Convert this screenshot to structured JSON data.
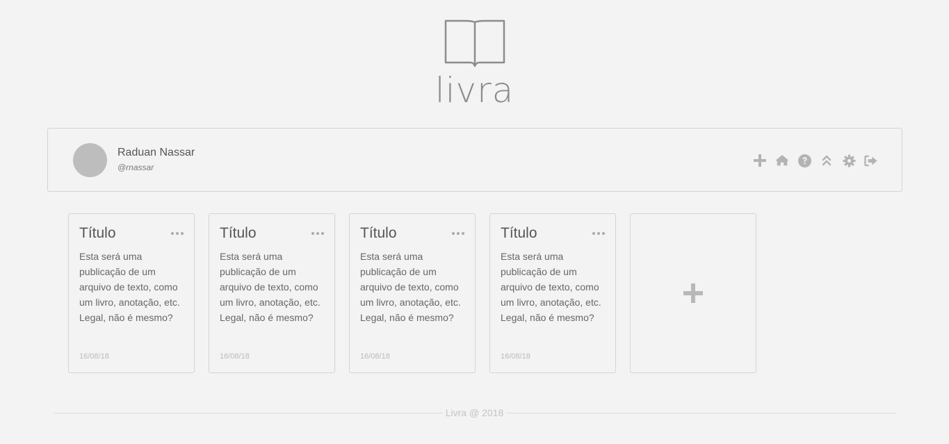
{
  "brand": {
    "name": "livra",
    "logo_icon": "open-book-icon"
  },
  "user": {
    "name": "Raduan Nassar",
    "handle": "@rnassar"
  },
  "toolbar": [
    {
      "icon": "plus-icon",
      "name": "add-button"
    },
    {
      "icon": "home-icon",
      "name": "home-button"
    },
    {
      "icon": "help-icon",
      "name": "help-button"
    },
    {
      "icon": "double-chevron-up-icon",
      "name": "collapse-button"
    },
    {
      "icon": "gear-icon",
      "name": "settings-button"
    },
    {
      "icon": "sign-out-icon",
      "name": "logout-button"
    }
  ],
  "cards": [
    {
      "title": "Título",
      "body": "Esta será uma publicação de um arquivo de texto, como um livro, anotação, etc. Legal, não é mesmo?",
      "date": "16/08/18"
    },
    {
      "title": "Título",
      "body": "Esta será uma publicação de um arquivo de texto, como um livro, anotação, etc. Legal, não é mesmo?",
      "date": "16/08/18"
    },
    {
      "title": "Título",
      "body": "Esta será uma publicação de um arquivo de texto, como um livro, anotação, etc. Legal, não é mesmo?",
      "date": "16/08/18"
    },
    {
      "title": "Título",
      "body": "Esta será uma publicação de um arquivo de texto, como um livro, anotação, etc. Legal, não é mesmo?",
      "date": "16/08/18"
    }
  ],
  "add_card_icon": "plus-icon",
  "footer": {
    "text": "Livra @ 2018"
  },
  "colors": {
    "background": "#f3f3f3",
    "icon": "#b3b3b3",
    "border": "#d4d4d4",
    "avatar": "#bdbdbd"
  }
}
